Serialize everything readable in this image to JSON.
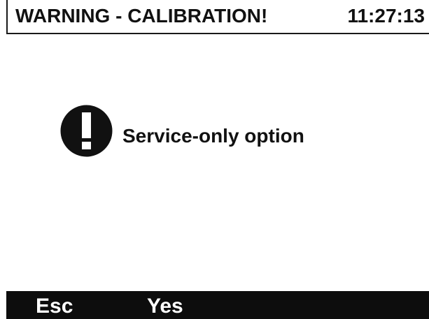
{
  "header": {
    "title": "WARNING - CALIBRATION!",
    "clock": "11:27:13"
  },
  "message": {
    "icon": "exclamation-circle-icon",
    "text": "Service-only option"
  },
  "softkeys": {
    "esc_label": "Esc",
    "yes_label": "Yes"
  },
  "colors": {
    "background": "#ffffff",
    "foreground": "#111111",
    "softkey_bar": "#0d0d0d",
    "softkey_text": "#ffffff"
  }
}
